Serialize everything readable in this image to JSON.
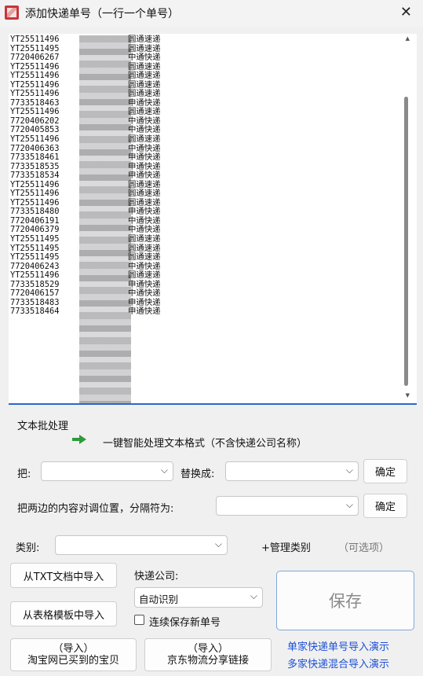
{
  "window": {
    "title": "添加快递单号（一行一个单号）",
    "close_glyph": "✕"
  },
  "tracking_lines": [
    "YT25511496",
    "YT25511495",
    "7720406267",
    "YT25511496",
    "YT25511496",
    "YT25511496",
    "YT25511496",
    "7733518463",
    "YT25511496",
    "7720406202",
    "7720405853",
    "YT25511496",
    "7720406363",
    "7733518461",
    "7733518535",
    "7733518534",
    "YT25511496",
    "YT25511496",
    "YT25511496",
    "7733518480",
    "7720406191",
    "7720406379",
    "YT25511495",
    "YT25511495",
    "YT25511495",
    "7720406243",
    "YT25511496",
    "7733518529",
    "7720406157",
    "7733518483",
    "7733518464"
  ],
  "carrier_lines": [
    "圆通速递",
    "圆通速递",
    "中通快递",
    "圆通速递",
    "圆通速递",
    "圆通速递",
    "圆通速递",
    "申通快递",
    "圆通速递",
    "中通快递",
    "中通快递",
    "圆通速递",
    "中通快递",
    "申通快递",
    "申通快递",
    "申通快递",
    "圆通速递",
    "圆通速递",
    "圆通速递",
    "申通快递",
    "中通快递",
    "中通快递",
    "圆通速递",
    "圆通速递",
    "圆通速递",
    "中通快递",
    "圆通速递",
    "申通快递",
    "中通快递",
    "申通快递",
    "申通快递"
  ],
  "batch": {
    "section_title": "文本批处理",
    "smart_format_hint": "一键智能处理文本格式（不含快递公司名称）",
    "replace_label": "把:",
    "replace_with_label": "替换成:",
    "confirm_label": "确定",
    "swap_label": "把两边的内容对调位置，分隔符为:",
    "swap_confirm_label": "确定"
  },
  "category": {
    "label": "类别:",
    "manage_label": "+管理类别",
    "optional_label": "（可选项）"
  },
  "import": {
    "txt_button": "从TXT文档中导入",
    "template_button": "从表格模板中导入",
    "taobao_line1": "（导入）",
    "taobao_line2": "淘宝网已买到的宝贝",
    "jd_line1": "（导入）",
    "jd_line2": "京东物流分享链接"
  },
  "courier": {
    "label": "快递公司:",
    "selected": "自动识别",
    "continuous_save_label": "连续保存新单号",
    "continuous_save_checked": false
  },
  "save_label": "保存",
  "links": {
    "single_demo": "单家快递单号导入演示",
    "multi_demo": "多家快递混合导入演示"
  },
  "colors": {
    "accent": "#2b67c9",
    "link": "#1b4fd6",
    "arrow": "#2e9b3a"
  }
}
